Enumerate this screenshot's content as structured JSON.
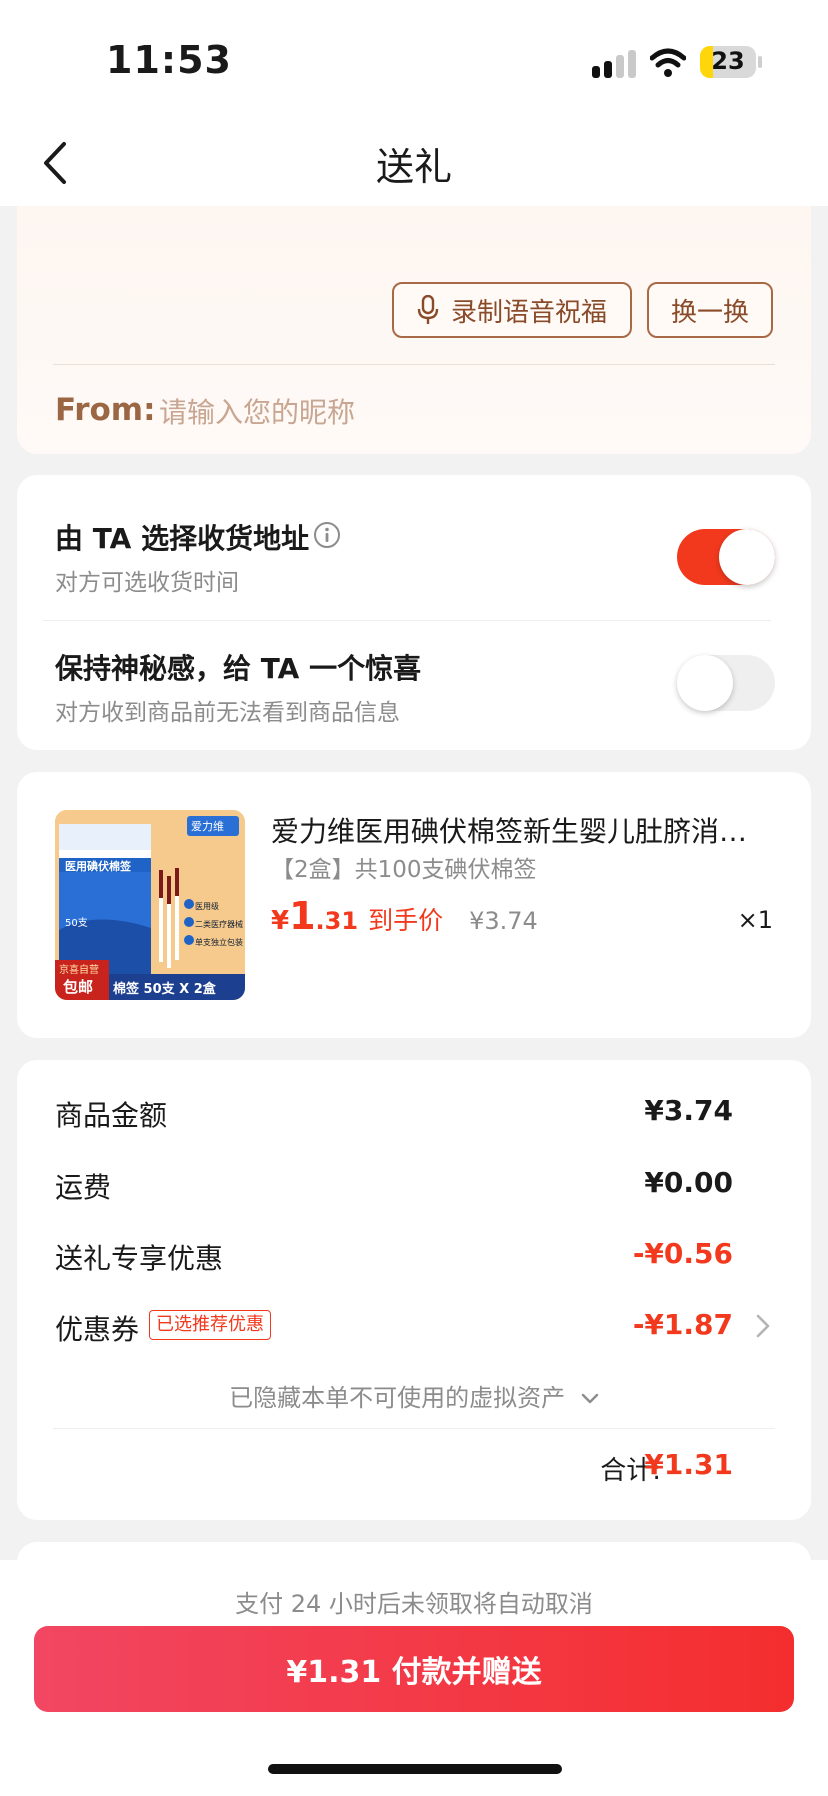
{
  "status_bar": {
    "time": "11:53",
    "battery": "23",
    "battery_level": 0.23
  },
  "nav": {
    "title": "送礼"
  },
  "greeting": {
    "voice_button": "录制语音祝福",
    "swap_button": "换一换",
    "from_label": "From:",
    "nickname_placeholder": "请输入您的昵称"
  },
  "options": {
    "choose_address": {
      "title": "由 TA 选择收货地址",
      "subtitle": "对方可选收货时间",
      "enabled": true
    },
    "keep_secret": {
      "title": "保持神秘感，给 TA 一个惊喜",
      "subtitle": "对方收到商品前无法看到商品信息",
      "enabled": false
    }
  },
  "product": {
    "name": "爱力维医用碘伏棉签新生婴儿肚脐消毒…",
    "spec": "【2盒】共100支碘伏棉签",
    "price_yen": "¥",
    "price_int": "1",
    "price_dec": ".31",
    "price_tag": "到手价",
    "original_price": "¥3.74",
    "quantity": "×1",
    "image": {
      "brand": "爱力维",
      "box_title": "医用碘伏棉签",
      "features": [
        "医用级",
        "二类医疗器械",
        "单支独立包装"
      ],
      "count": "50支",
      "self_operated": "京喜自营",
      "free_shipping": "包邮",
      "caption": "棉签 50支 X 2盒"
    }
  },
  "summary": {
    "rows": [
      {
        "label": "商品金额",
        "value": "¥3.74"
      },
      {
        "label": "运费",
        "value": "¥0.00"
      },
      {
        "label": "送礼专享优惠",
        "value": "-¥0.56"
      },
      {
        "label": "优惠券",
        "value": "-¥1.87"
      }
    ],
    "coupon_badge": "已选推荐优惠",
    "hidden_assets": "已隐藏本单不可使用的虚拟资产",
    "total_label": "合计:",
    "total_value": "¥1.31"
  },
  "footer": {
    "cancel_note": "支付 24 小时后未领取将自动取消",
    "pay_button": "¥1.31 付款并赠送"
  },
  "colors": {
    "accent_red": "#f2391d",
    "brown": "#9a6644"
  }
}
